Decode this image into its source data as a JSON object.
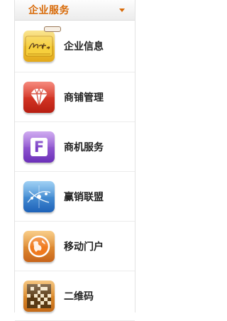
{
  "menu": {
    "title": "企业服务",
    "items": [
      {
        "label": "企业信息",
        "icon": "notebook-icon",
        "icon_text": "Notes"
      },
      {
        "label": "商铺管理",
        "icon": "diamond-icon"
      },
      {
        "label": "商机服务",
        "icon": "f-letter-icon",
        "icon_text": "F"
      },
      {
        "label": "赢销联盟",
        "icon": "network-icon"
      },
      {
        "label": "移动门户",
        "icon": "globe-icon"
      },
      {
        "label": "二维码",
        "icon": "qr-code-icon"
      }
    ]
  },
  "colors": {
    "accent": "#d86a08",
    "label": "#222222",
    "divider": "#ececec"
  }
}
